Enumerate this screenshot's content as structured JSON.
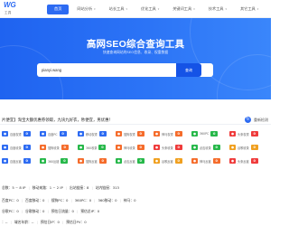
{
  "logo": {
    "mark": "WG",
    "sub": "工具"
  },
  "nav": [
    {
      "label": "首页",
      "active": true,
      "caret": false
    },
    {
      "label": "网站分析",
      "active": false,
      "caret": true
    },
    {
      "label": "站长工具",
      "active": false,
      "caret": true
    },
    {
      "label": "优化工具",
      "active": false,
      "caret": true
    },
    {
      "label": "关键词工具",
      "active": false,
      "caret": true
    },
    {
      "label": "技术工具",
      "active": false,
      "caret": true
    },
    {
      "label": "其它工具",
      "active": false,
      "caret": true
    }
  ],
  "hero": {
    "title": "高网SEO综合查询工具",
    "subtitle": "快速查询网站的SEO信息、收录、权重数据",
    "search_value": "pianyi.wang",
    "search_button": "查询"
  },
  "info": {
    "text": "片便宜】淘宝大额优惠券领取，九块九好衣，秒便宜，男优惠！",
    "refresh_label": "重新检测",
    "refresh_icon": "refresh-icon"
  },
  "metric_rows": [
    [
      {
        "label": "百度权重",
        "icon_color": "#2d6bf2",
        "badge": "0",
        "badge_color": "#2d6bf2",
        "icon": "baidu-icon"
      },
      {
        "label": "百度PC",
        "icon_color": "#2d6bf2",
        "badge": "0",
        "badge_color": "#2d6bf2",
        "icon": "baidu-icon"
      },
      {
        "label": "移动权重",
        "icon_color": "#2d6bf2",
        "badge": "0",
        "badge_color": "#2d6bf2",
        "icon": "mobile-icon"
      },
      {
        "label": "搜狗权重",
        "icon_color": "#f56c2b",
        "badge": "0",
        "badge_color": "#f56c2b",
        "icon": "sogou-icon"
      },
      {
        "label": "神马权重",
        "icon_color": "#f56c2b",
        "badge": "0",
        "badge_color": "#f56c2b",
        "icon": "shenma-icon"
      },
      {
        "label": "360PC",
        "icon_color": "#27b84a",
        "badge": "0",
        "badge_color": "#27b84a",
        "icon": "360-icon"
      },
      {
        "label": "头条权重",
        "icon_color": "#ef3b3b",
        "badge": "0",
        "badge_color": "#ef3b3b",
        "icon": "toutiao-icon"
      }
    ],
    [
      {
        "label": "百度收录",
        "icon_color": "#2d6bf2",
        "badge": "0",
        "badge_color": "#2d6bf2",
        "icon": "baidu-icon"
      },
      {
        "label": "搜狗收录",
        "icon_color": "#f56c2b",
        "badge": "0",
        "badge_color": "#f56c2b",
        "icon": "sogou-icon"
      },
      {
        "label": "360收录",
        "icon_color": "#27b84a",
        "badge": "0",
        "badge_color": "#27b84a",
        "icon": "360-icon"
      },
      {
        "label": "神马收录",
        "icon_color": "#f56c2b",
        "badge": "0",
        "badge_color": "#f56c2b",
        "icon": "shenma-icon"
      },
      {
        "label": "头条收录",
        "icon_color": "#ef3b3b",
        "badge": "0",
        "badge_color": "#ef3b3b",
        "icon": "toutiao-icon"
      },
      {
        "label": "必应收录",
        "icon_color": "#27b84a",
        "badge": "0",
        "badge_color": "#27b84a",
        "icon": "bing-icon"
      },
      {
        "label": "谷歌收录",
        "icon_color": "#f0a020",
        "badge": "0",
        "badge_color": "#f0a020",
        "icon": "google-icon"
      }
    ],
    [
      {
        "label": "百度反链",
        "icon_color": "#2d6bf2",
        "badge": "0",
        "badge_color": "#2d6bf2",
        "icon": "baidu-icon"
      },
      {
        "label": "360反链",
        "icon_color": "#27b84a",
        "badge": "0",
        "badge_color": "#27b84a",
        "icon": "360-icon"
      },
      {
        "label": "搜狗反链",
        "icon_color": "#f56c2b",
        "badge": "0",
        "badge_color": "#f56c2b",
        "icon": "sogou-icon"
      },
      {
        "label": "必应反链",
        "icon_color": "#27b84a",
        "badge": "0",
        "badge_color": "#27b84a",
        "icon": "bing-icon"
      },
      {
        "label": "谷歌反链",
        "icon_color": "#f0a020",
        "badge": "0",
        "badge_color": "#f0a020",
        "icon": "google-icon"
      },
      {
        "label": "神马反链",
        "icon_color": "#f56c2b",
        "badge": "0",
        "badge_color": "#f56c2b",
        "icon": "shenma-icon"
      },
      {
        "label": "头条反链",
        "icon_color": "#ef3b3b",
        "badge": "0",
        "badge_color": "#ef3b3b",
        "icon": "toutiao-icon"
      }
    ]
  ],
  "stats_rows": [
    [
      "总数：5 ~ 8 IP",
      "移动来路：1 ~ 2 IP",
      "出站链接：8",
      "站内链接：313"
    ],
    [
      "百度PC：0",
      "百度移动：0",
      "搜狗PC：0",
      "360PC：0",
      "360移动：0",
      "神马：0"
    ],
    [
      "谷歌PC：0",
      "谷歌移动：0",
      "预估日流量：0",
      "预估总IP：0"
    ],
    [
      "：--",
      "域名年龄：--",
      "预估日IP：0",
      "预估日PV：0"
    ]
  ]
}
